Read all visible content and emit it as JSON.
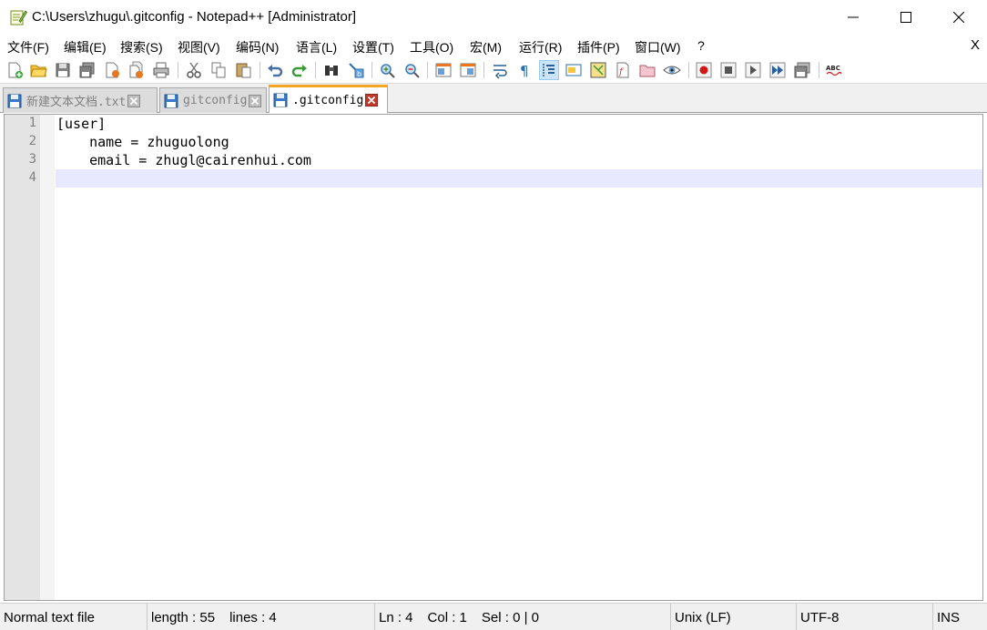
{
  "window": {
    "title": "C:\\Users\\zhugu\\.gitconfig - Notepad++ [Administrator]"
  },
  "menu": {
    "items": [
      "文件(F)",
      "编辑(E)",
      "搜索(S)",
      "视图(V)",
      "编码(N)",
      "语言(L)",
      "设置(T)",
      "工具(O)",
      "宏(M)",
      "运行(R)",
      "插件(P)",
      "窗口(W)",
      "?"
    ],
    "close_label": "X"
  },
  "tabs": [
    {
      "label": "新建文本文档.txt",
      "active": false
    },
    {
      "label": "gitconfig",
      "active": false
    },
    {
      "label": ".gitconfig",
      "active": true
    }
  ],
  "editor": {
    "line_numbers": [
      "1",
      "2",
      "3",
      "4"
    ],
    "lines": [
      "[user]",
      "    name = zhuguolong",
      "    email = zhugl@cairenhui.com",
      ""
    ]
  },
  "status": {
    "file_type": "Normal text file",
    "length": "length : 55",
    "lines": "lines : 4",
    "ln": "Ln : 4",
    "col": "Col : 1",
    "sel": "Sel : 0 | 0",
    "eol": "Unix (LF)",
    "encoding": "UTF-8",
    "mode": "INS"
  },
  "colors": {
    "tab_active_accent": "#f5a623",
    "current_line": "#e8e8ff",
    "gutter": "#e4e4e4"
  }
}
